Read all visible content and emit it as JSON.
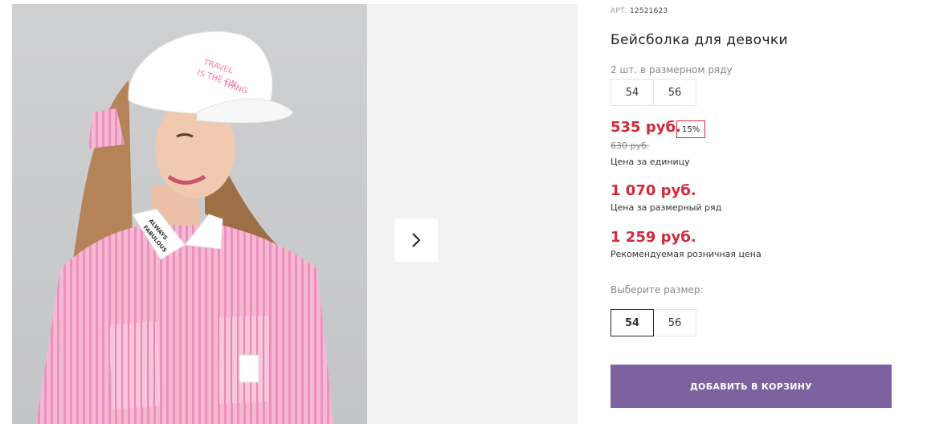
{
  "product": {
    "sku_label": "АРТ:",
    "sku_value": "12521623",
    "title": "Бейсболка для девочки",
    "pack_note": "2 шт. в размерном ряду",
    "pack_sizes": [
      "54",
      "56"
    ],
    "price": "535 руб.",
    "discount": "15%",
    "old_price": "630 руб.",
    "unit_label": "Цена за единицу",
    "pack_price": "1 070 руб.",
    "pack_label": "Цена за размерный ряд",
    "retail_price": "1 259 руб.",
    "retail_label": "Рекомендуемая розничная цена",
    "choose_size_label": "Выберите размер:",
    "size_options": [
      "54",
      "56"
    ],
    "selected_size": "54",
    "add_to_cart": "ДОБАВИТЬ В КОРЗИНУ"
  },
  "gallery": {
    "cap_text": [
      "TRAVEL",
      "IS THE ON",
      "THING"
    ],
    "collar_text": [
      "ALWAYS",
      "FABULOUS"
    ],
    "next_icon": "chevron-right-icon"
  },
  "colors": {
    "price_red": "#d32a3b",
    "button_purple": "#7c63a0",
    "shirt_pink": "#f2a7c9"
  }
}
